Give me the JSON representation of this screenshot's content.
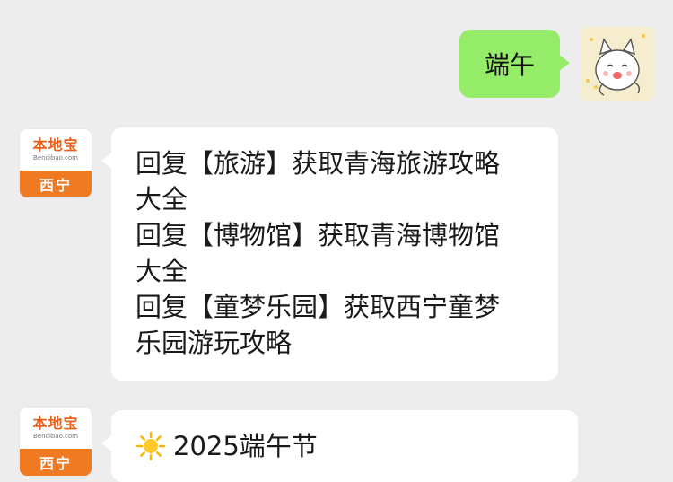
{
  "conversation": {
    "outgoing": {
      "text": "端午",
      "bubble_color": "#95ec69"
    },
    "incoming": [
      {
        "avatar": {
          "logo": "本地宝",
          "logo_sub": "Bendibao.com",
          "city": "西宁",
          "accent": "#f07a22"
        },
        "text": "回复【旅游】获取青海旅游攻略\n大全\n回复【博物馆】获取青海博物馆\n大全\n回复【童梦乐园】获取西宁童梦\n乐园游玩攻略"
      },
      {
        "avatar": {
          "logo": "本地宝",
          "logo_sub": "Bendibao.com",
          "city": "西宁"
        },
        "icon": "sun-icon",
        "text": "2025端午节"
      }
    ]
  },
  "colors": {
    "background": "#ededed",
    "incoming_bubble": "#ffffff"
  }
}
